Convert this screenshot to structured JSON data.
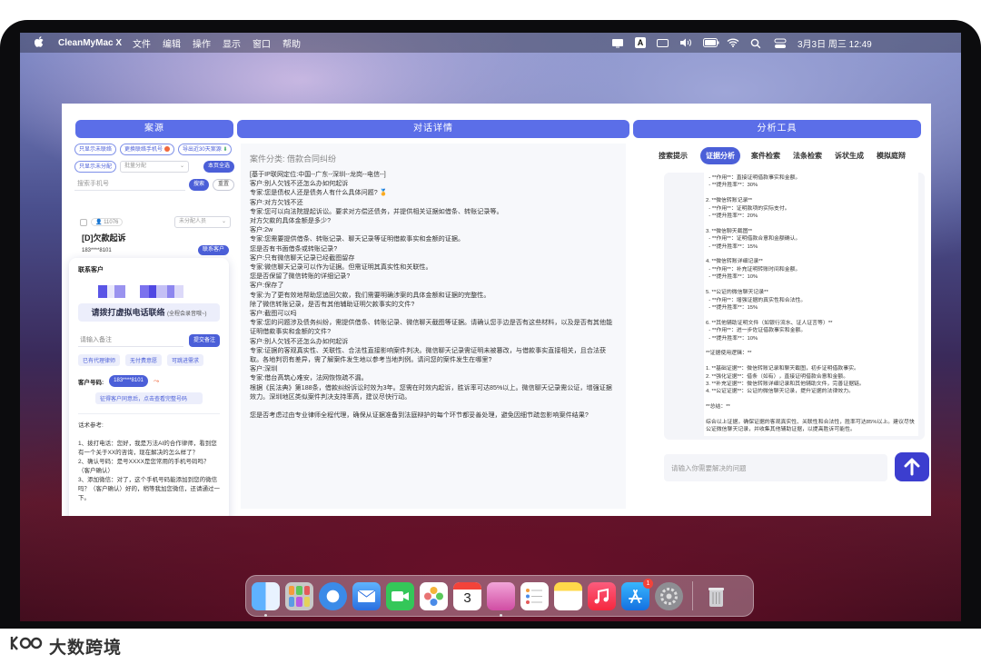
{
  "menubar": {
    "app_name": "CleanMyMac X",
    "menus": [
      "文件",
      "编辑",
      "操作",
      "显示",
      "窗口",
      "帮助"
    ],
    "status_letter": "A",
    "datetime": "3月3日 周三  12:49"
  },
  "columns": {
    "left_title": "案源",
    "mid_title": "对话详情",
    "right_title": "分析工具"
  },
  "left": {
    "chips_row1": [
      "只显示未联络",
      "更换联络手机号",
      "导出近30天案源"
    ],
    "chip_unassigned": "只显示未分配",
    "batch_select": "批量分配",
    "my_cases": "本页全选",
    "search_placeholder": "搜索手机号",
    "search_btn": "搜索",
    "reset_btn": "重置",
    "case_id": "11076",
    "case_assign": "未分配人员",
    "case_title": "[D]欠款起诉",
    "case_phone": "183****8101",
    "contact_btn": "联系客户",
    "contact_title": "联系客户",
    "call_label": "请拨打虚拟电话联络",
    "call_sub": "(全程会录音哦~)",
    "note_placeholder": "请输入备注",
    "submit_note": "提交备注",
    "tags": [
      "已有代理律师",
      "无付费意愿",
      "可跳进需求"
    ],
    "phone_label": "客户号码:",
    "phone_value": "183****8101",
    "consent_btn": "征得客户同意后，点击查看完整号码",
    "script_title": "话术参考:",
    "script_text": "1、拨打电话：您好，我是万法AI的合作律师，看到您有一个关于XX的咨询，现在解决的怎么样了？\n2、确认号码：是号XXXX是您常用的手机号码吗？（客户确认）\n3、添加微信：对了，这个手机号码能添加到您的微信吗？（客户确认）好的，稍等我加您微信，还请通过一下。"
  },
  "mid": {
    "case_type_label": "案件分类:",
    "case_type_value": "借款合同纠纷",
    "dialog": "[基于IP联网定位:中国--广东--深圳--龙岗--电信--]\n客户:别人欠钱不还怎么办如何起诉\n专家:您是债权人还是债务人有什么具体问题? 🏅\n客户:对方欠钱不还\n专家:您可以向法院提起诉讼。要求对方偿还债务，并提供相关证据如借条、转账记录等。\n对方欠款的具体金额是多少?\n客户:2w\n专家:您需要提供借条、转账记录、聊天记录等证明借款事实和金额的证据。\n您是否有书面借条或转账记录?\n客户:只有微信聊天记录已经截图留存\n专家:微信聊天记录可以作为证据。但需证明其真实性和关联性。\n您是否保留了微信转账的详细记录?\n客户:保存了\n专家:为了更有效地帮助您追回欠款，我们需要明确涉案的具体金额和证据的完整性。\n除了微信转账记录，是否有其他辅助证明欠款事实的文件?\n客户:截图可以吗\n专家:您的问题涉及债务纠纷，需提供借条、转账记录、微信聊天截图等证据。请确认您手边是否有这些材料，以及是否有其他能证明借款事实和金额的文件?\n客户:别人欠钱不还怎么办如何起诉\n专家:证据的客观真实性、关联性、合法性直接影响案件判决。微信聊天记录需证明未被篡改，与借款事实直接相关，且合法获取。各地判罚有差异，需了解案件发生地以参考当地判例。请问您的案件发生在哪里?\n客户:深圳\n专家:借台高筑心难安，法网恢恢疏不漏。\n根据《民法典》第188条，借款纠纷诉讼时效为3年。您需在时效内起诉，胜诉率可达85%以上。微信聊天记录需公证，增强证据效力。深圳地区类似案件判决支持率高，建议尽快行动。\n\n您是否考虑过由专业律师全程代理，确保从证据准备到法庭辩护的每个环节都妥善处理，避免因细节疏忽影响案件结果?"
  },
  "right": {
    "tabs": [
      "搜索提示",
      "证据分析",
      "案件检索",
      "法条检索",
      "诉状生成",
      "模拟庭辩"
    ],
    "active_tab": "证据分析",
    "analysis_text": "  - **作用**：直接证明借款事实和金额。\n  - **提升胜率**：30%\n\n2. **微信转账记录**\n  - **作用**：证明款项的实际支付。\n  - **提升胜率**：20%\n\n3. **微信聊天截图**\n  - **作用**：证明借款合意和金额确认。\n  - **提升胜率**：15%\n\n4. **微信转账详细记录**\n  - **作用**：补充证明转账时间和金额。\n  - **提升胜率**：10%\n\n5. **公证的微信聊天记录**\n  - **作用**：增强证据的真实性和合法性。\n  - **提升胜率**：15%\n\n6. **其他辅助证明文件（如银行流水、证人证言等）**\n  - **作用**：进一步佐证借款事实和金额。\n  - **提升胜率**：10%\n\n**证据使用逻辑：**\n\n1. **基础证据**：微信转账记录和聊天截图，初步证明借款事实。\n2. **强化证据**：借条（如有），直接证明借款合意和金额。\n3. **补充证据**：微信转账详细记录和其他辅助文件，完善证据链。\n4. **公证证据**：公证的微信聊天记录，提升证据的法律效力。\n\n**总结：**\n\n综合以上证据，确保证据的客观真实性、关联性和合法性，胜率可达85%以上。建议尽快公证微信聊天记录，并收集其他辅助证据，以提高胜诉可能性。",
    "ask_placeholder": "请输入你需要解决的问题"
  },
  "dock": {
    "calendar_day": "3",
    "appstore_badge": "1"
  },
  "watermark": "大数跨境"
}
